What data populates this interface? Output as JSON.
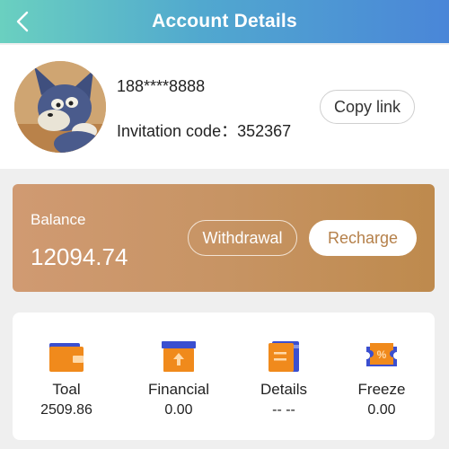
{
  "header": {
    "title": "Account Details",
    "back_icon": "chevron-left-icon"
  },
  "profile": {
    "avatar_icon": "cat-avatar",
    "phone": "188****8888",
    "invitation_label": "Invitation code：352367",
    "copy_button": "Copy link"
  },
  "balance": {
    "label": "Balance",
    "value": "12094.74",
    "withdraw_button": "Withdrawal",
    "recharge_button": "Recharge"
  },
  "stats": [
    {
      "label": "Toal",
      "value": "2509.86",
      "icon": "wallet-icon"
    },
    {
      "label": "Financial",
      "value": "0.00",
      "icon": "upload-box-icon"
    },
    {
      "label": "Details",
      "value": "-- --",
      "icon": "ledger-icon"
    },
    {
      "label": "Freeze",
      "value": "0.00",
      "icon": "coupon-icon"
    }
  ],
  "colors": {
    "header_start": "#6ad0c0",
    "header_end": "#4a86d8",
    "balance_card": "#c79464",
    "recharge_text": "#b5804a",
    "icon_orange": "#f08a1c",
    "icon_blue": "#3a4fd0"
  }
}
